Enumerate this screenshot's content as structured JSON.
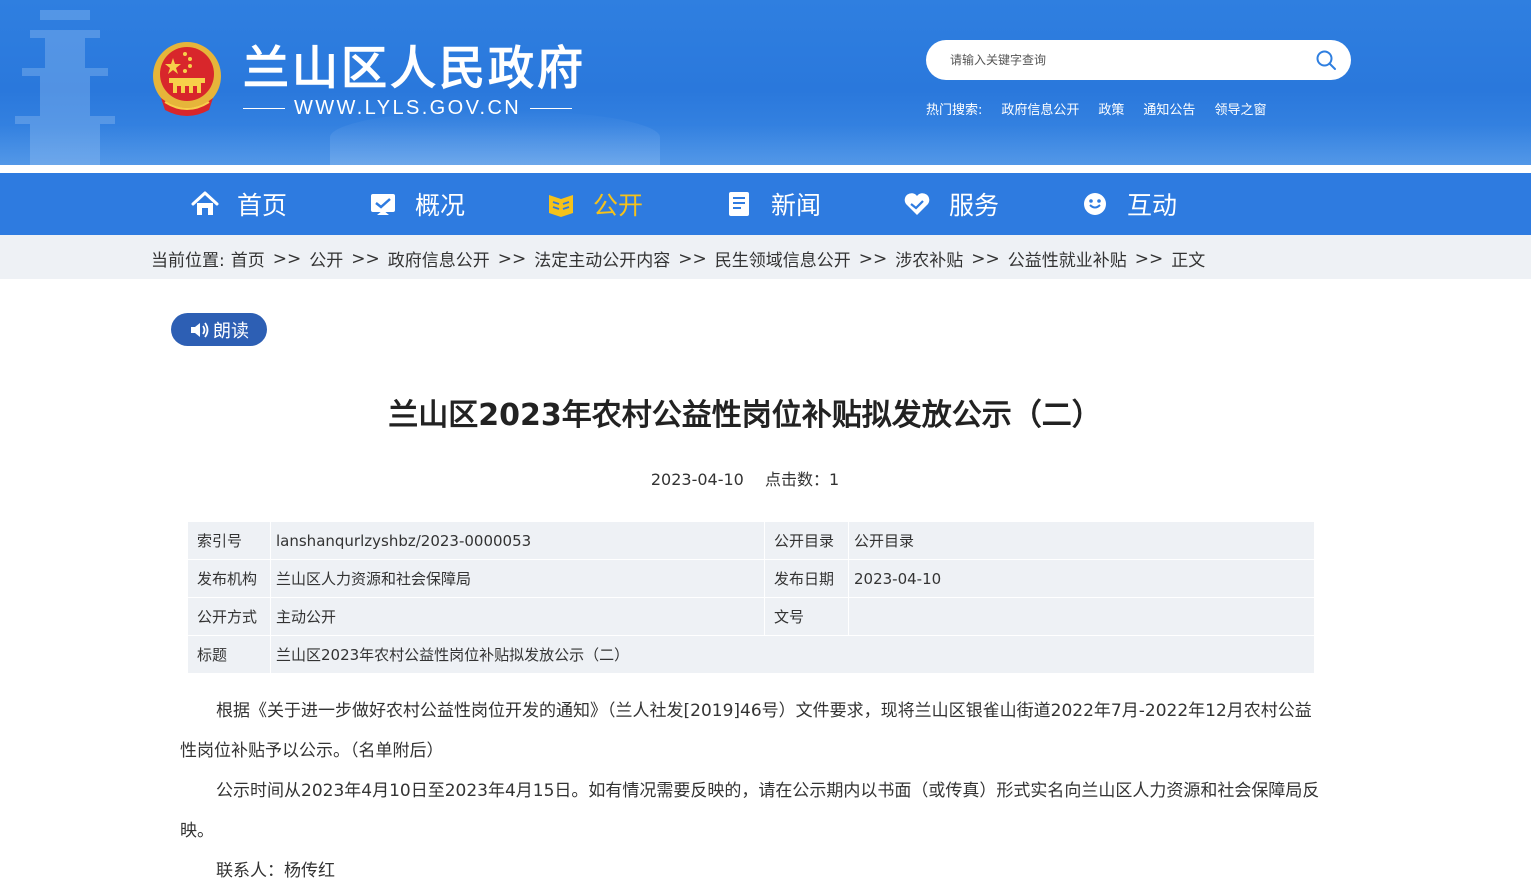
{
  "header": {
    "site_name": "兰山区人民政府",
    "site_url": "WWW.LYLS.GOV.CN",
    "search_placeholder": "请输入关键字查询",
    "hot_label": "热门搜索:",
    "hot_links": [
      "政府信息公开",
      "政策",
      "通知公告",
      "领导之窗"
    ]
  },
  "nav": {
    "items": [
      {
        "label": "首页",
        "icon": "home-icon"
      },
      {
        "label": "概况",
        "icon": "overview-icon"
      },
      {
        "label": "公开",
        "icon": "disclosure-icon",
        "active": true
      },
      {
        "label": "新闻",
        "icon": "news-icon"
      },
      {
        "label": "服务",
        "icon": "service-icon"
      },
      {
        "label": "互动",
        "icon": "interaction-icon"
      }
    ],
    "active_color": "#f5c21b"
  },
  "breadcrumb": {
    "prefix": "当前位置:",
    "items": [
      "首页",
      "公开",
      "政府信息公开",
      "法定主动公开内容",
      "民生领域信息公开",
      "涉农补贴",
      "公益性就业补贴",
      "正文"
    ],
    "separator": ">>"
  },
  "read_button": "朗读",
  "article": {
    "title": "兰山区2023年农村公益性岗位补贴拟发放公示（二）",
    "date": "2023-04-10",
    "clicks": "点击数：1",
    "info": {
      "index_label": "索引号",
      "index_value": "lanshanqurlzyshbz/2023-0000053",
      "catalog_label": "公开目录",
      "catalog_value": "公开目录",
      "org_label": "发布机构",
      "org_value": "兰山区人力资源和社会保障局",
      "pubdate_label": "发布日期",
      "pubdate_value": "2023-04-10",
      "mode_label": "公开方式",
      "mode_value": "主动公开",
      "docno_label": "文号",
      "docno_value": "",
      "subject_label": "标题",
      "subject_value": "兰山区2023年农村公益性岗位补贴拟发放公示（二）"
    },
    "paragraphs": [
      "根据《关于进一步做好农村公益性岗位开发的通知》（兰人社发[2019]46号）文件要求，现将兰山区银雀山街道2022年7月-2022年12月农村公益性岗位补贴予以公示。（名单附后）",
      "公示时间从2023年4月10日至2023年4月15日。如有情况需要反映的，请在公示期内以书面（或传真）形式实名向兰山区人力资源和社会保障局反映。",
      "联系人：杨传红"
    ]
  },
  "colors": {
    "header_blue": "#2f7fe0",
    "nav_blue": "#2e7be0",
    "read_button": "#2d5fb4",
    "table_bg": "#eef1f5"
  }
}
